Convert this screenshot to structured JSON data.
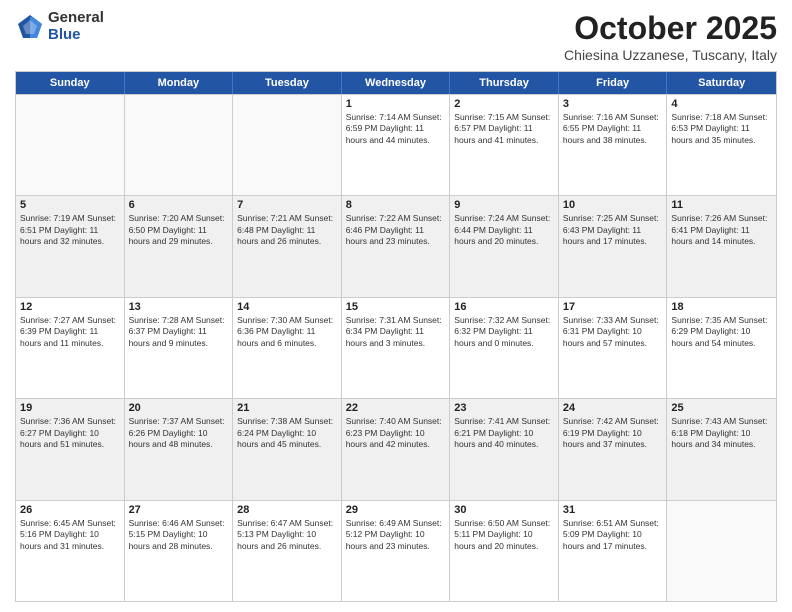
{
  "logo": {
    "general": "General",
    "blue": "Blue"
  },
  "title": "October 2025",
  "location": "Chiesina Uzzanese, Tuscany, Italy",
  "days_of_week": [
    "Sunday",
    "Monday",
    "Tuesday",
    "Wednesday",
    "Thursday",
    "Friday",
    "Saturday"
  ],
  "weeks": [
    [
      {
        "day": "",
        "text": "",
        "empty": true
      },
      {
        "day": "",
        "text": "",
        "empty": true
      },
      {
        "day": "",
        "text": "",
        "empty": true
      },
      {
        "day": "1",
        "text": "Sunrise: 7:14 AM\nSunset: 6:59 PM\nDaylight: 11 hours and 44 minutes."
      },
      {
        "day": "2",
        "text": "Sunrise: 7:15 AM\nSunset: 6:57 PM\nDaylight: 11 hours and 41 minutes."
      },
      {
        "day": "3",
        "text": "Sunrise: 7:16 AM\nSunset: 6:55 PM\nDaylight: 11 hours and 38 minutes."
      },
      {
        "day": "4",
        "text": "Sunrise: 7:18 AM\nSunset: 6:53 PM\nDaylight: 11 hours and 35 minutes."
      }
    ],
    [
      {
        "day": "5",
        "text": "Sunrise: 7:19 AM\nSunset: 6:51 PM\nDaylight: 11 hours and 32 minutes.",
        "shaded": true
      },
      {
        "day": "6",
        "text": "Sunrise: 7:20 AM\nSunset: 6:50 PM\nDaylight: 11 hours and 29 minutes.",
        "shaded": true
      },
      {
        "day": "7",
        "text": "Sunrise: 7:21 AM\nSunset: 6:48 PM\nDaylight: 11 hours and 26 minutes.",
        "shaded": true
      },
      {
        "day": "8",
        "text": "Sunrise: 7:22 AM\nSunset: 6:46 PM\nDaylight: 11 hours and 23 minutes.",
        "shaded": true
      },
      {
        "day": "9",
        "text": "Sunrise: 7:24 AM\nSunset: 6:44 PM\nDaylight: 11 hours and 20 minutes.",
        "shaded": true
      },
      {
        "day": "10",
        "text": "Sunrise: 7:25 AM\nSunset: 6:43 PM\nDaylight: 11 hours and 17 minutes.",
        "shaded": true
      },
      {
        "day": "11",
        "text": "Sunrise: 7:26 AM\nSunset: 6:41 PM\nDaylight: 11 hours and 14 minutes.",
        "shaded": true
      }
    ],
    [
      {
        "day": "12",
        "text": "Sunrise: 7:27 AM\nSunset: 6:39 PM\nDaylight: 11 hours and 11 minutes."
      },
      {
        "day": "13",
        "text": "Sunrise: 7:28 AM\nSunset: 6:37 PM\nDaylight: 11 hours and 9 minutes."
      },
      {
        "day": "14",
        "text": "Sunrise: 7:30 AM\nSunset: 6:36 PM\nDaylight: 11 hours and 6 minutes."
      },
      {
        "day": "15",
        "text": "Sunrise: 7:31 AM\nSunset: 6:34 PM\nDaylight: 11 hours and 3 minutes."
      },
      {
        "day": "16",
        "text": "Sunrise: 7:32 AM\nSunset: 6:32 PM\nDaylight: 11 hours and 0 minutes."
      },
      {
        "day": "17",
        "text": "Sunrise: 7:33 AM\nSunset: 6:31 PM\nDaylight: 10 hours and 57 minutes."
      },
      {
        "day": "18",
        "text": "Sunrise: 7:35 AM\nSunset: 6:29 PM\nDaylight: 10 hours and 54 minutes."
      }
    ],
    [
      {
        "day": "19",
        "text": "Sunrise: 7:36 AM\nSunset: 6:27 PM\nDaylight: 10 hours and 51 minutes.",
        "shaded": true
      },
      {
        "day": "20",
        "text": "Sunrise: 7:37 AM\nSunset: 6:26 PM\nDaylight: 10 hours and 48 minutes.",
        "shaded": true
      },
      {
        "day": "21",
        "text": "Sunrise: 7:38 AM\nSunset: 6:24 PM\nDaylight: 10 hours and 45 minutes.",
        "shaded": true
      },
      {
        "day": "22",
        "text": "Sunrise: 7:40 AM\nSunset: 6:23 PM\nDaylight: 10 hours and 42 minutes.",
        "shaded": true
      },
      {
        "day": "23",
        "text": "Sunrise: 7:41 AM\nSunset: 6:21 PM\nDaylight: 10 hours and 40 minutes.",
        "shaded": true
      },
      {
        "day": "24",
        "text": "Sunrise: 7:42 AM\nSunset: 6:19 PM\nDaylight: 10 hours and 37 minutes.",
        "shaded": true
      },
      {
        "day": "25",
        "text": "Sunrise: 7:43 AM\nSunset: 6:18 PM\nDaylight: 10 hours and 34 minutes.",
        "shaded": true
      }
    ],
    [
      {
        "day": "26",
        "text": "Sunrise: 6:45 AM\nSunset: 5:16 PM\nDaylight: 10 hours and 31 minutes."
      },
      {
        "day": "27",
        "text": "Sunrise: 6:46 AM\nSunset: 5:15 PM\nDaylight: 10 hours and 28 minutes."
      },
      {
        "day": "28",
        "text": "Sunrise: 6:47 AM\nSunset: 5:13 PM\nDaylight: 10 hours and 26 minutes."
      },
      {
        "day": "29",
        "text": "Sunrise: 6:49 AM\nSunset: 5:12 PM\nDaylight: 10 hours and 23 minutes."
      },
      {
        "day": "30",
        "text": "Sunrise: 6:50 AM\nSunset: 5:11 PM\nDaylight: 10 hours and 20 minutes."
      },
      {
        "day": "31",
        "text": "Sunrise: 6:51 AM\nSunset: 5:09 PM\nDaylight: 10 hours and 17 minutes."
      },
      {
        "day": "",
        "text": "",
        "empty": true
      }
    ]
  ]
}
